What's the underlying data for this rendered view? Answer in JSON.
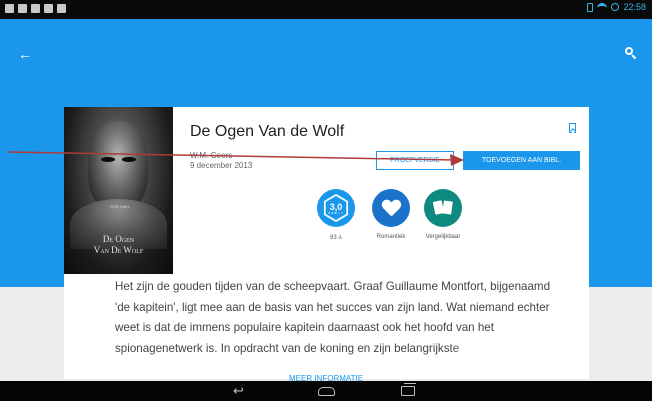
{
  "status_bar": {
    "time": "22:58"
  },
  "header": {
    "back_icon": "arrow-left-icon",
    "search_icon": "search-icon",
    "color": "#1a97ea"
  },
  "book": {
    "title": "De Ogen Van de Wolf",
    "author": "W.M. Geers",
    "date": "9 december 2013",
    "cover_author": "W.M. Geers",
    "cover_title_line1": "De Ogen",
    "cover_title_line2": "Van De Wolf"
  },
  "actions": {
    "preview_label": "PROEFVERSIE",
    "add_label": "TOEVOEGEN AAN BIBL."
  },
  "stats": {
    "rating_value": "3,0",
    "rating_stars": "★★★☆☆",
    "rating_count": "93 ⅄",
    "genre_label": "Romantiek",
    "similar_label": "Vergelijkbaar"
  },
  "description": "Het zijn de gouden tijden van de scheepvaart. Graaf Guillaume Montfort, bijgenaamd 'de kapitein', ligt mee aan de basis van het succes van zijn land. Wat niemand echter weet is dat de immens populaire kapitein daarnaast ook het hoofd van het spionagenetwerk is. In opdracht van de koning en zijn belangrijkste",
  "more_info_label": "MEER INFORMATIE",
  "annotation_color": "#b03a3a"
}
